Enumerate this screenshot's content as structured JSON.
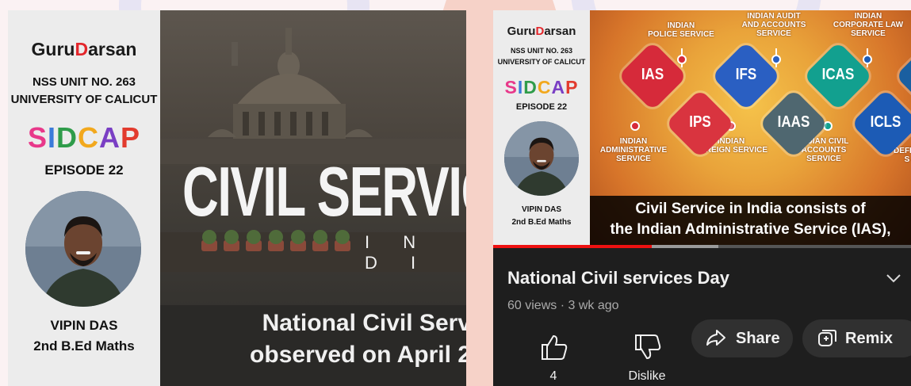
{
  "left_card": {
    "brand_prefix": "Guru",
    "brand_d": "D",
    "brand_suffix": "arsan",
    "unit": "NSS UNIT NO. 263",
    "university": "UNIVERSITY OF CALICUT",
    "series_letters": [
      {
        "ch": "S",
        "color": "#e8388a"
      },
      {
        "ch": "I",
        "color": "#3b7bd9"
      },
      {
        "ch": "D",
        "color": "#2f9c4a"
      },
      {
        "ch": "C",
        "color": "#f2a81d"
      },
      {
        "ch": "A",
        "color": "#7a3fc4"
      },
      {
        "ch": "P",
        "color": "#e23b2e"
      }
    ],
    "episode": "EPISODE 22",
    "presenter_name": "VIPIN DAS",
    "presenter_role": "2nd B.Ed Maths",
    "headline": "CIVIL SERVIC",
    "subheadline": "I N D I",
    "caption_line1": "National Civil Serv",
    "caption_line2": "observed on April 2"
  },
  "right_card": {
    "brand_prefix": "Guru",
    "brand_d": "D",
    "brand_suffix": "arsan",
    "unit": "NSS UNIT NO. 263",
    "university": "UNIVERSITY OF CALICUT",
    "episode": "EPISODE 22",
    "presenter_name": "VIPIN DAS",
    "presenter_role": "2nd B.Ed Maths",
    "diamonds": [
      {
        "label": "IAS",
        "color": "#d62a3a"
      },
      {
        "label": "IFS",
        "color": "#2a5fc2"
      },
      {
        "label": "ICAS",
        "color": "#12a08f"
      },
      {
        "label": "IPS",
        "color": "#d9343f"
      },
      {
        "label": "IAAS",
        "color": "#4f6770"
      },
      {
        "label": "ICLS",
        "color": "#1c5bb5"
      },
      {
        "label": "",
        "color": "#1a5fa0"
      }
    ],
    "labels": {
      "police": "INDIAN\nPOLICE SERVICE",
      "audit": "INDIAN AUDIT\nAND ACCOUNTS\nSERVICE",
      "corporate": "INDIAN\nCORPORATE LAW\nSERVICE",
      "admin": "INDIAN\nADMINISTRATIVE\nSERVICE",
      "foreign": "INDIAN\nFOREIGN SERVICE",
      "civil_accounts": "INDIAN CIVIL\nACCOUNTS\nSERVICE",
      "defence": "DEFEN\nS"
    },
    "caption_line1": "Civil Service in India consists of",
    "caption_line2": "the Indian Administrative Service (IAS),",
    "progress": 0.38,
    "buffered": 0.54,
    "video_title": "National Civil services Day",
    "views": "60 views",
    "separator": "·",
    "age": "3 wk ago",
    "like_count": "4",
    "dislike_label": "Dislike",
    "share_label": "Share",
    "remix_label": "Remix"
  }
}
